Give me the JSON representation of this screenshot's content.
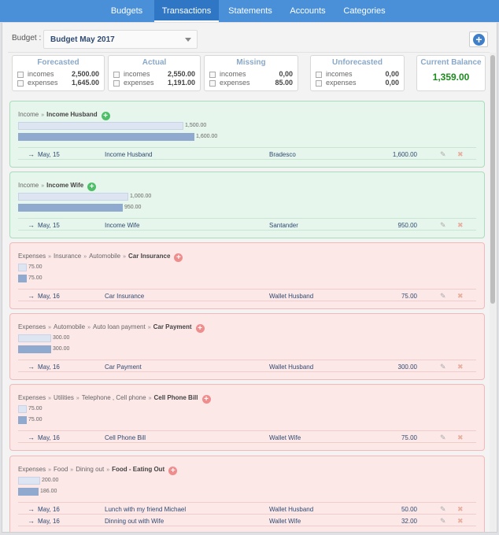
{
  "nav": {
    "tabs": [
      "Budgets",
      "Transactions",
      "Statements",
      "Accounts",
      "Categories"
    ],
    "active": "Transactions"
  },
  "budget": {
    "label": "Budget :",
    "selected": "Budget May 2017"
  },
  "summary": {
    "forecasted": {
      "title": "Forecasted",
      "incomes_label": "incomes",
      "incomes": "2,500.00",
      "expenses_label": "expenses",
      "expenses": "1,645.00"
    },
    "actual": {
      "title": "Actual",
      "incomes_label": "incomes",
      "incomes": "2,550.00",
      "expenses_label": "expenses",
      "expenses": "1,191.00"
    },
    "missing": {
      "title": "Missing",
      "incomes_label": "incomes",
      "incomes": "0,00",
      "expenses_label": "expenses",
      "expenses": "85.00"
    },
    "unforecasted": {
      "title": "Unforecasted",
      "incomes_label": "incomes",
      "incomes": "0,00",
      "expenses_label": "expenses",
      "expenses": "0,00"
    },
    "balance": {
      "title": "Current Balance",
      "value": "1,359.00"
    }
  },
  "colors": {
    "income_bg": "#e7f6ec",
    "expense_bg": "#fde8e8",
    "nav": "#4a90d9",
    "balance": "#1d8a1d"
  },
  "categories": [
    {
      "kind": "income",
      "path": [
        "Income"
      ],
      "name": "Income Husband",
      "forecast_label": "1,500.00",
      "forecast_value": 1500,
      "actual_label": "1,600.00",
      "actual_value": 1600,
      "rows": [
        {
          "date": "May, 15",
          "desc": "Income Husband",
          "account": "Bradesco",
          "amount": "1,600.00"
        }
      ]
    },
    {
      "kind": "income",
      "path": [
        "Income"
      ],
      "name": "Income Wife",
      "forecast_label": "1,000.00",
      "forecast_value": 1000,
      "actual_label": "950.00",
      "actual_value": 950,
      "rows": [
        {
          "date": "May, 15",
          "desc": "Income Wife",
          "account": "Santander",
          "amount": "950.00"
        }
      ]
    },
    {
      "kind": "expense",
      "path": [
        "Expenses",
        "Insurance",
        "Automobile"
      ],
      "name": "Car Insurance",
      "forecast_label": "75.00",
      "forecast_value": 75,
      "actual_label": "75.00",
      "actual_value": 75,
      "rows": [
        {
          "date": "May, 16",
          "desc": "Car Insurance",
          "account": "Wallet Husband",
          "amount": "75.00"
        }
      ]
    },
    {
      "kind": "expense",
      "path": [
        "Expenses",
        "Automobile",
        "Auto loan payment"
      ],
      "name": "Car Payment",
      "forecast_label": "300.00",
      "forecast_value": 300,
      "actual_label": "300.00",
      "actual_value": 300,
      "rows": [
        {
          "date": "May, 16",
          "desc": "Car Payment",
          "account": "Wallet Husband",
          "amount": "300.00"
        }
      ]
    },
    {
      "kind": "expense",
      "path": [
        "Expenses",
        "Utilities",
        "Telephone , Cell phone"
      ],
      "name": "Cell Phone Bill",
      "forecast_label": "75.00",
      "forecast_value": 75,
      "actual_label": "75.00",
      "actual_value": 75,
      "rows": [
        {
          "date": "May, 16",
          "desc": "Cell Phone Bill",
          "account": "Wallet Wife",
          "amount": "75.00"
        }
      ]
    },
    {
      "kind": "expense",
      "path": [
        "Expenses",
        "Food",
        "Dining out"
      ],
      "name": "Food - Eating Out",
      "forecast_label": "200.00",
      "forecast_value": 200,
      "actual_label": "186.00",
      "actual_value": 186,
      "rows": [
        {
          "date": "May, 16",
          "desc": "Lunch with my friend Michael",
          "account": "Wallet Husband",
          "amount": "50.00"
        },
        {
          "date": "May, 16",
          "desc": "Dinning out with Wife",
          "account": "Wallet Wife",
          "amount": "32.00"
        }
      ]
    }
  ]
}
